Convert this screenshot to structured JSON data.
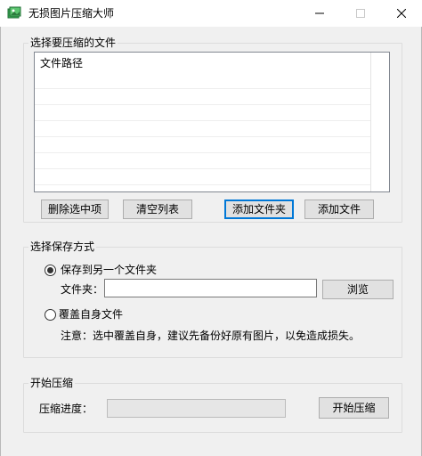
{
  "window": {
    "title": "无损图片压缩大师"
  },
  "file_group": {
    "title": "选择要压缩的文件",
    "list_header": "文件路径",
    "buttons": {
      "delete_selected": "删除选中项",
      "clear_list": "清空列表",
      "add_folder": "添加文件夹",
      "add_file": "添加文件"
    }
  },
  "save_group": {
    "title": "选择保存方式",
    "option_other_folder": "保存到另一个文件夹",
    "folder_label": "文件夹：",
    "folder_value": "",
    "browse": "浏览",
    "option_overwrite": "覆盖自身文件",
    "note": "注意：选中覆盖自身，建议先备份好原有图片，以免造成损失。",
    "selected": "other_folder"
  },
  "compress_group": {
    "title": "开始压缩",
    "progress_label": "压缩进度：",
    "progress_value": 0,
    "start": "开始压缩"
  },
  "colors": {
    "focus_border": "#0078d7",
    "button_bg": "#e1e1e1",
    "window_bg": "#f0f0f0"
  }
}
